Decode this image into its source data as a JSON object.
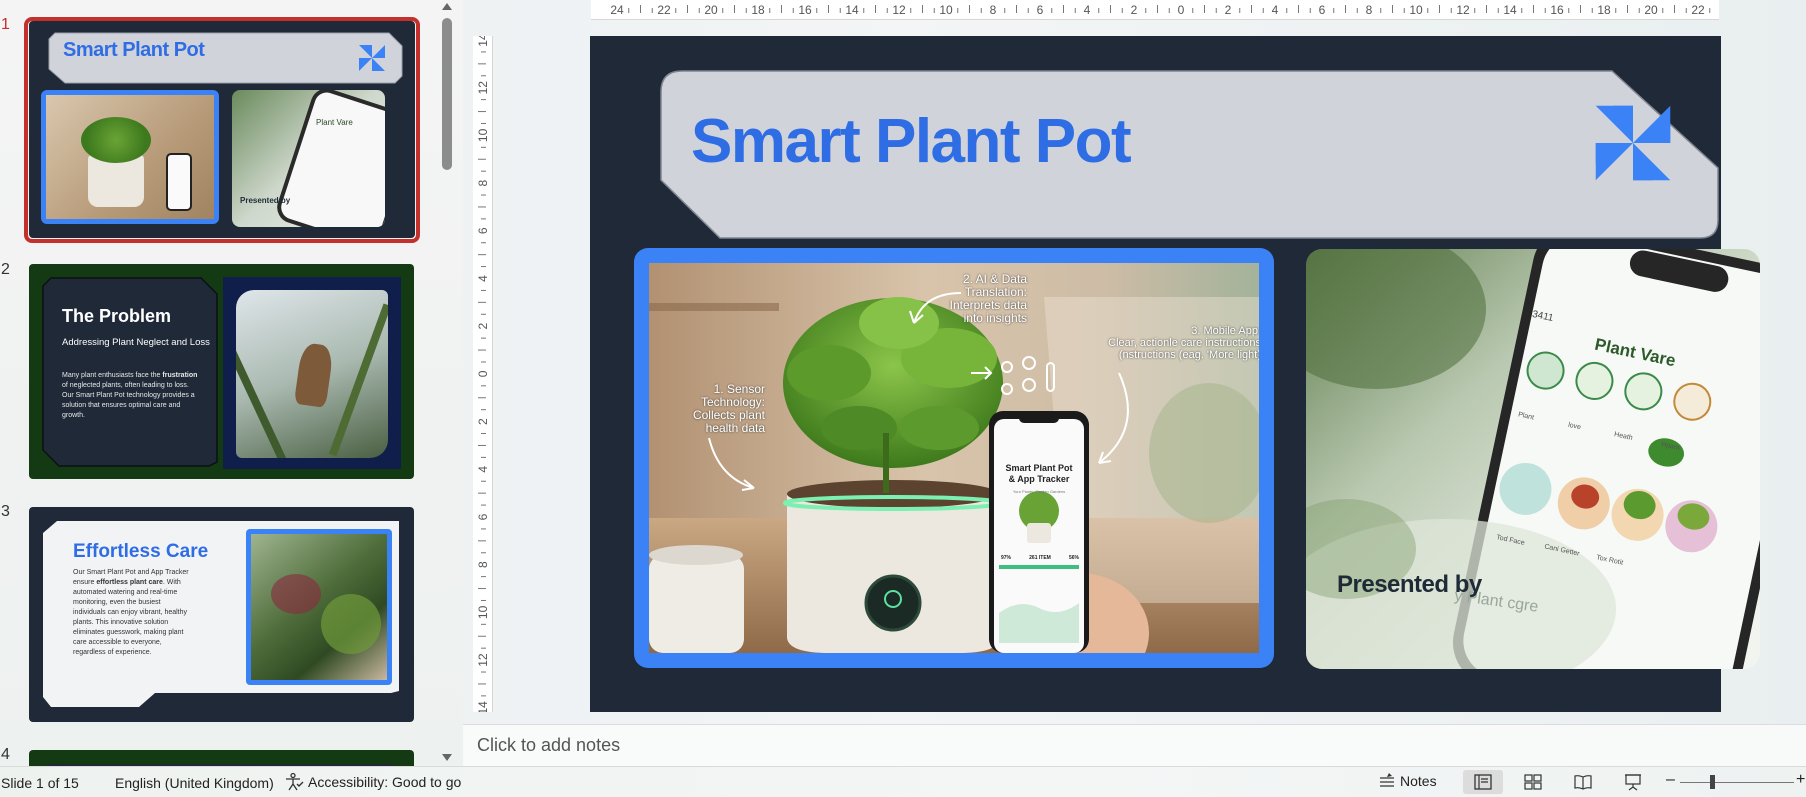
{
  "thumbnails": [
    {
      "number": "1",
      "title": "Smart Plant Pot",
      "caption": "Presented by",
      "phone_title": "Plant Vare"
    },
    {
      "number": "2",
      "title": "The Problem",
      "subtitle": "Addressing Plant Neglect and Loss",
      "body_pre": "Many plant enthusiasts face the ",
      "body_bold": "frustration",
      "body_post": " of neglected plants, often leading to loss. Our Smart Plant Pot technology provides a solution that ensures optimal care and growth."
    },
    {
      "number": "3",
      "title": "Effortless Care",
      "body_pre": "Our Smart Plant Pot and App Tracker ensure ",
      "body_bold": "effortless plant care",
      "body_post": ". With automated watering and real-time monitoring, even the busiest individuals can enjoy vibrant, healthy plants. This innovative solution eliminates guesswork, making plant care accessible to everyone, regardless of experience."
    },
    {
      "number": "4"
    }
  ],
  "ruler": {
    "horizontal": [
      "24",
      "22",
      "20",
      "18",
      "16",
      "14",
      "12",
      "10",
      "8",
      "6",
      "4",
      "2",
      "0",
      "2",
      "4",
      "6",
      "8",
      "10",
      "12",
      "14",
      "16",
      "18",
      "20",
      "22",
      "24"
    ],
    "vertical": [
      "14",
      "12",
      "10",
      "8",
      "6",
      "4",
      "2",
      "0",
      "2",
      "4",
      "6",
      "8",
      "10",
      "12",
      "14"
    ]
  },
  "slide": {
    "title": "Smart Plant Pot",
    "presented_by": "Presented by",
    "infographic": {
      "step1": [
        "1. Sensor Technology:",
        "Collects plant",
        "health data"
      ],
      "step2": [
        "2. AI & Data",
        "Translation:",
        "Interprets data",
        "into insights"
      ],
      "step3": [
        "3. Mobile App:",
        "Clear, actionle care instructions",
        "(nstructions (eag. 'More light)"
      ],
      "phone_title": [
        "Smart Plant Pot",
        "& App Tracker"
      ],
      "phone_sub": "Your Plants: Garden Gardens",
      "stats": [
        "97%",
        "261 ITEM",
        "56%"
      ]
    },
    "side_phone": {
      "time": "3411",
      "title": "Plant Vare",
      "labels": [
        "Plant",
        "love",
        "Heath",
        "Hpant"
      ],
      "plants": [
        "Tod Face",
        "Cani Getter",
        "Tox Rotit"
      ],
      "faded": "y Plant cgre"
    }
  },
  "notes": {
    "placeholder": "Click to add notes"
  },
  "status_bar": {
    "slide_counter": "Slide 1 of 15",
    "language": "English (United Kingdom)",
    "accessibility": "Accessibility: Good to go",
    "notes_button": "Notes",
    "zoom_minus": "–",
    "zoom_plus": "+"
  },
  "colors": {
    "accent_blue": "#3b82f6",
    "title_blue": "#2f6de5",
    "slide_bg": "#1f2937",
    "selection_red": "#c4302b"
  }
}
